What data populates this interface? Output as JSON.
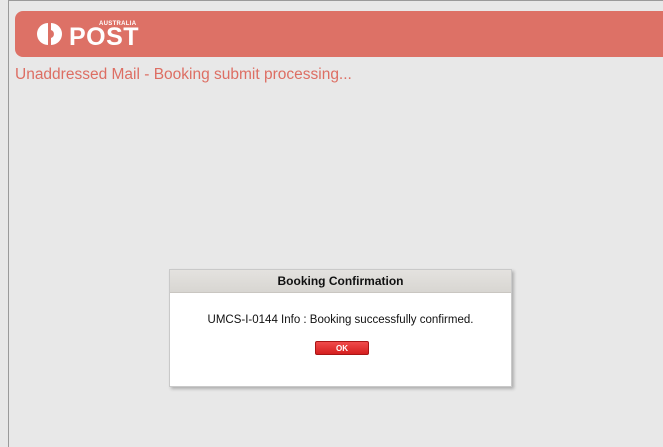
{
  "header": {
    "logo_small": "AUSTRALIA",
    "logo_word": "POST",
    "background_color": "#dd7166"
  },
  "page": {
    "title": "Unaddressed Mail - Booking submit processing..."
  },
  "dialog": {
    "title": "Booking Confirmation",
    "message": "UMCS-I-0144 Info : Booking successfully confirmed.",
    "ok_label": "OK",
    "ok_color": "#d51f1f"
  }
}
